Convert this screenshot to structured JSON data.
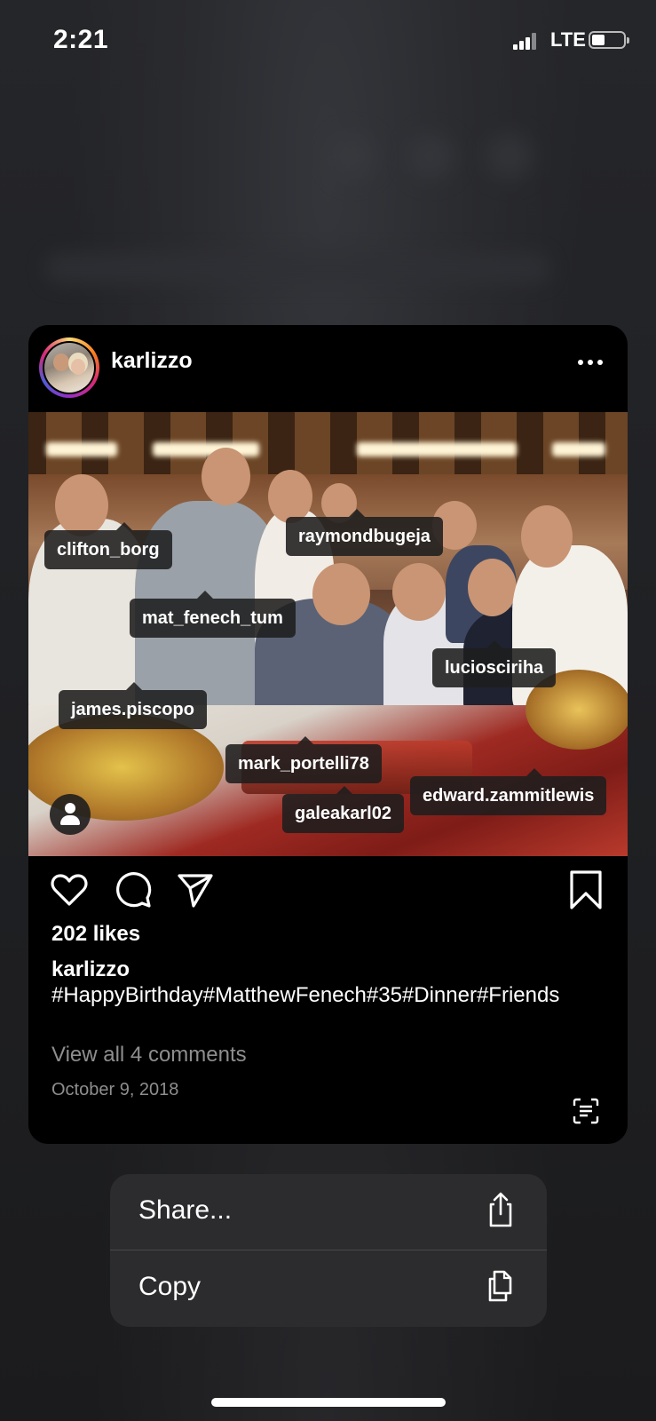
{
  "status_bar": {
    "time": "2:21",
    "network": "LTE",
    "icons": [
      "signal-icon",
      "battery-icon"
    ]
  },
  "post": {
    "username": "karlizzo",
    "likes": "202 likes",
    "caption_user": "karlizzo",
    "caption": "#HappyBirthday#MatthewFenech#35#Dinner#Friends",
    "comments_link": "View all 4 comments",
    "date": "October 9, 2018",
    "tags": [
      "clifton_borg",
      "raymondbugeja",
      "mat_fenech_tum",
      "luciosciriha",
      "james.piscopo",
      "mark_portelli78",
      "edward.zammitlewis",
      "galeakarl02"
    ],
    "icons": [
      "more-icon",
      "heart-icon",
      "comment-icon",
      "send-icon",
      "bookmark-icon",
      "tagged-people-icon",
      "scan-text-icon"
    ]
  },
  "menu": {
    "share_label": "Share...",
    "copy_label": "Copy",
    "icons": [
      "share-icon",
      "copy-icon"
    ]
  },
  "colors": {
    "card_bg": "#000000",
    "menu_bg": "#2c2c2e",
    "secondary_text": "#8e8e8e"
  }
}
